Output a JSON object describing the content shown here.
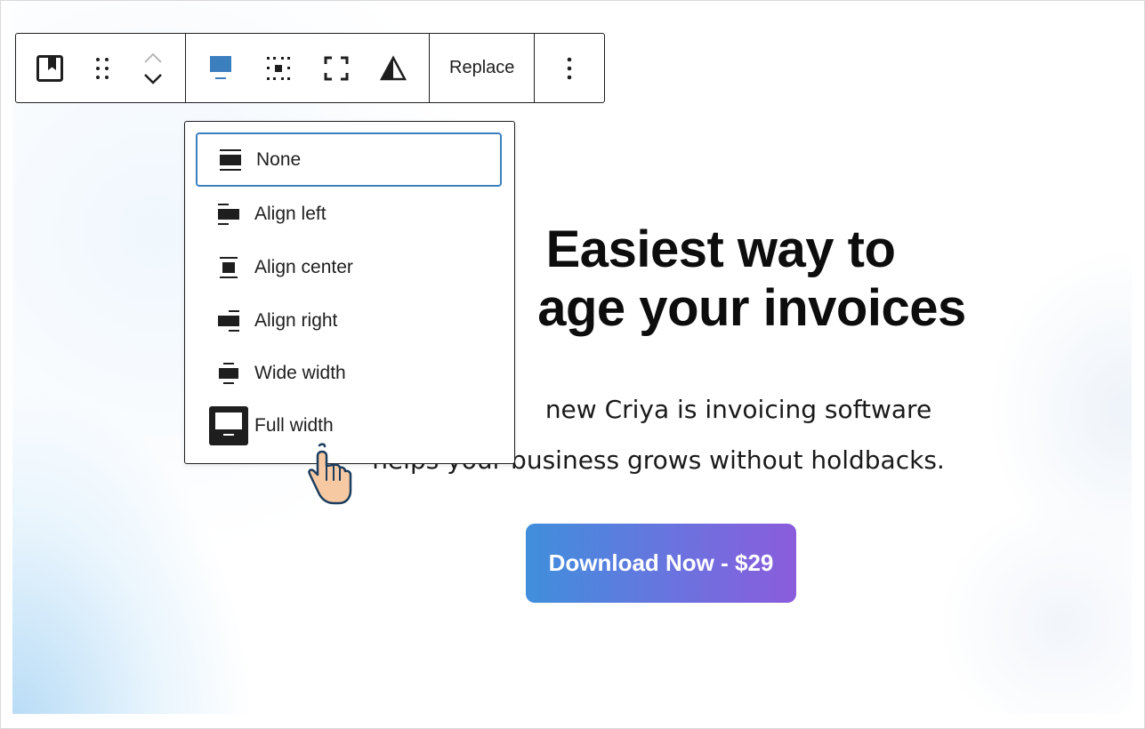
{
  "toolbar": {
    "parent_block_icon": "bookmark-block-icon",
    "drag_handle_icon": "drag-handle-icon",
    "move_icons": [
      "chevron-up-icon",
      "chevron-down-icon"
    ],
    "align_icon": "align-none-icon",
    "duotone_icon": "grid-dots-icon",
    "crop_icon": "crop-corners-icon",
    "filter_icon": "triangle-contrast-icon",
    "replace_label": "Replace",
    "more_icon": "vertical-ellipsis-icon",
    "accent_color": "#3b7fbf"
  },
  "alignment_menu": {
    "items": [
      {
        "label": "None",
        "icon": "align-none-icon",
        "selected": true
      },
      {
        "label": "Align left",
        "icon": "align-left-icon",
        "selected": false
      },
      {
        "label": "Align center",
        "icon": "align-center-icon",
        "selected": false
      },
      {
        "label": "Align right",
        "icon": "align-right-icon",
        "selected": false
      },
      {
        "label": "Wide width",
        "icon": "wide-width-icon",
        "selected": false
      },
      {
        "label": "Full width",
        "icon": "full-width-icon",
        "selected": false
      }
    ]
  },
  "hero": {
    "headline_line1": "Easiest way to",
    "headline_line2": "age your invoices",
    "subtext_line1": "new Criya is invoicing software",
    "subtext_line2": "helps your business grows without holdbacks.",
    "cta_label": "Download Now - $29",
    "cta_gradient": [
      "#3f8fdc",
      "#8b5cdc"
    ]
  },
  "cursor": {
    "icon": "pointer-hand-icon"
  }
}
